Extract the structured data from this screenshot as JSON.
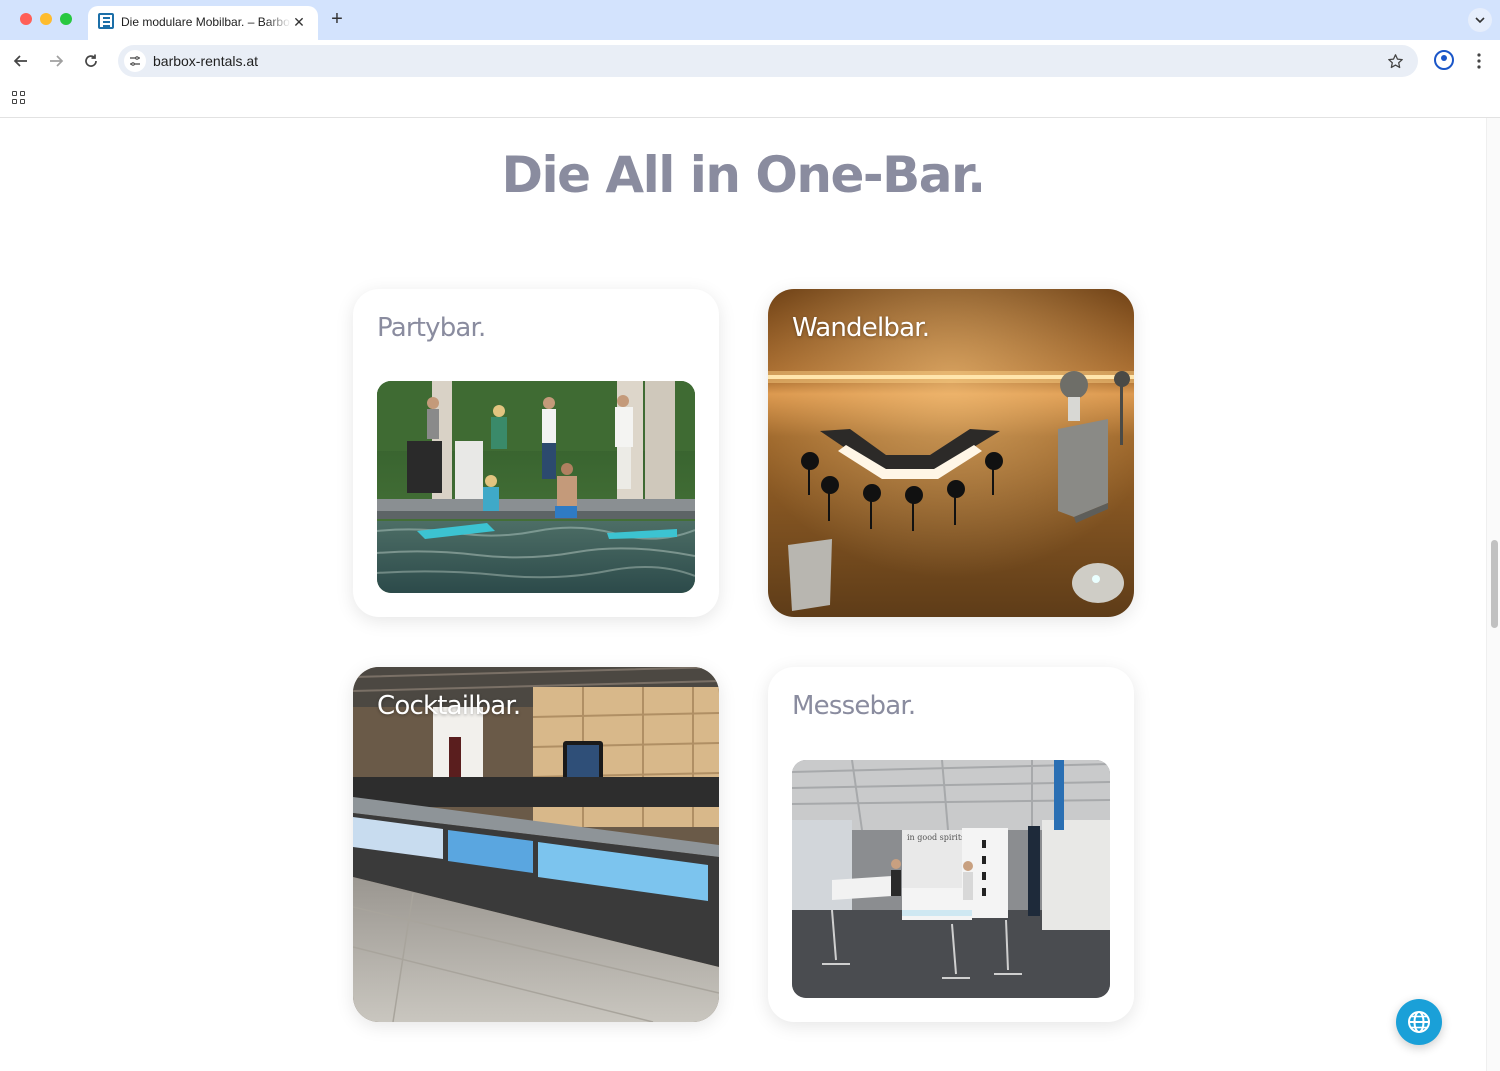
{
  "browser": {
    "tab_title": "Die modulare Mobilbar. – Barbox",
    "tab_close": "✕",
    "new_tab": "+",
    "url": "barbox-rentals.at"
  },
  "page": {
    "headline": "Die All in One-Bar.",
    "cards": [
      {
        "title": "Partybar."
      },
      {
        "title": "Wandelbar."
      },
      {
        "title": "Cocktailbar."
      },
      {
        "title": "Messebar.",
        "sign_text": "in good spirits"
      }
    ]
  },
  "icons": {
    "back": "arrow-left-icon",
    "forward": "arrow-right-icon",
    "reload": "reload-icon",
    "star": "star-icon",
    "language": "globe-icon"
  },
  "colors": {
    "title_gray": "#8a8c9f",
    "accent_blue": "#1aa0d8",
    "tabbar": "#d3e3fd"
  }
}
